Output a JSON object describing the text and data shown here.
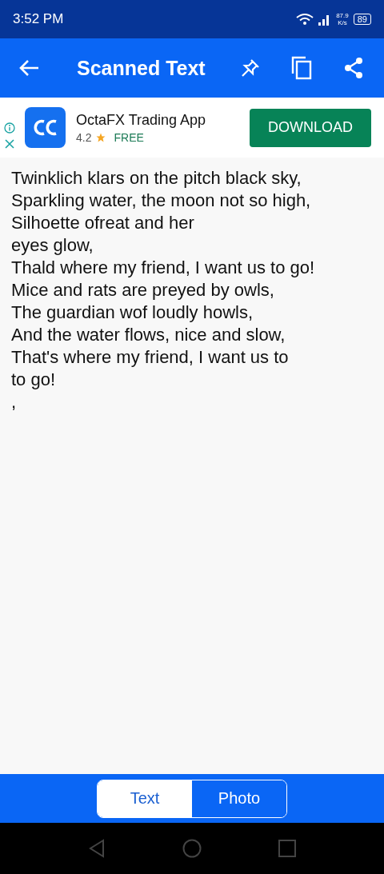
{
  "status_bar": {
    "time": "3:52 PM",
    "speed_value": "87.9",
    "speed_unit": "K/s",
    "battery": "89"
  },
  "app_bar": {
    "title": "Scanned Text"
  },
  "ad": {
    "app_name": "OctaFX Trading App",
    "rating": "4.2",
    "price": "FREE",
    "button": "DOWNLOAD"
  },
  "scanned_lines": [
    "Twinklich klars on the pitch black sky,",
    "Sparkling water, the moon not so high,",
    "Silhoette ofreat and her",
    "eyes glow,",
    "Thald where my friend, I want us to go!",
    "Mice and rats are preyed by owls,",
    "The guardian wof loudly howls,",
    "And the water flows, nice and slow,",
    "That's where my friend, I want us to",
    "to go!",
    ","
  ],
  "tabs": [
    {
      "label": "Text",
      "selected": true
    },
    {
      "label": "Photo",
      "selected": false
    }
  ]
}
